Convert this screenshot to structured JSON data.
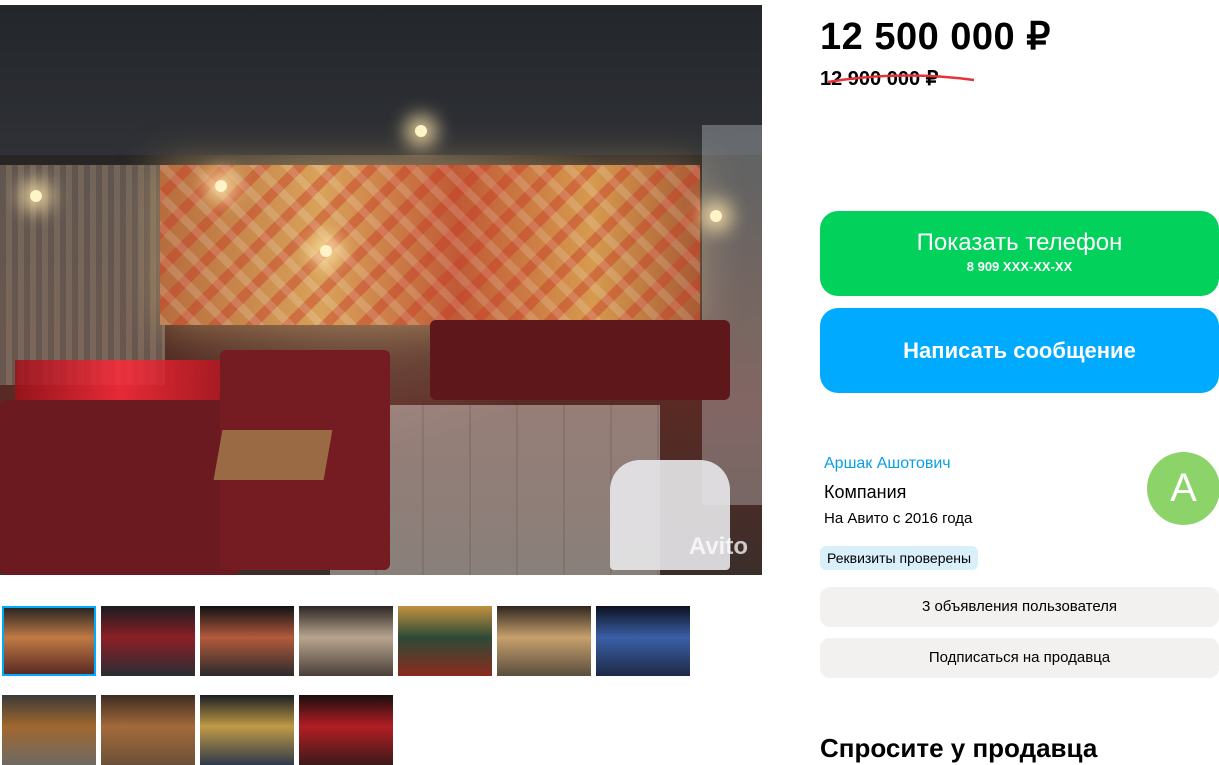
{
  "gallery": {
    "watermark": "Avito",
    "thumbnails": [
      {
        "alt": "photo-1",
        "colors": [
          "#5a2a24",
          "#c07a44",
          "#2a2624"
        ],
        "active": true
      },
      {
        "alt": "photo-2",
        "colors": [
          "#2b2c33",
          "#8b1f26",
          "#1a1c21"
        ]
      },
      {
        "alt": "photo-3",
        "colors": [
          "#2b2a2c",
          "#b35a3c",
          "#0f1014"
        ]
      },
      {
        "alt": "photo-4",
        "colors": [
          "#4a3f39",
          "#b8a58f",
          "#2c2623"
        ]
      },
      {
        "alt": "photo-5",
        "colors": [
          "#8a2b1e",
          "#2d4a37",
          "#c2913f"
        ]
      },
      {
        "alt": "photo-6",
        "colors": [
          "#5a4d3f",
          "#c7a06c",
          "#2e2620"
        ]
      },
      {
        "alt": "photo-7",
        "colors": [
          "#1d2a44",
          "#3b5fa6",
          "#0c1120"
        ]
      },
      {
        "alt": "photo-8",
        "colors": [
          "#6e6a63",
          "#a0682f",
          "#3c3a37"
        ]
      },
      {
        "alt": "photo-9",
        "colors": [
          "#6b5138",
          "#a36a3a",
          "#3d2c22"
        ]
      },
      {
        "alt": "photo-10",
        "colors": [
          "#2f3a4a",
          "#c09a45",
          "#1a1e24"
        ]
      },
      {
        "alt": "photo-11",
        "colors": [
          "#3c1a1a",
          "#b21e24",
          "#1a0e0e"
        ]
      }
    ]
  },
  "price": {
    "current": "12 500 000 ₽",
    "old": "12 900 000 ₽"
  },
  "actions": {
    "show_phone_label": "Показать телефон",
    "phone_masked": "8 909 XXX-XX-XX",
    "write_message_label": "Написать сообщение"
  },
  "seller": {
    "name": "Аршак Ашотович",
    "type": "Компания",
    "since": "На Авито с 2016 года",
    "avatar_letter": "А",
    "verified_badge": "Реквизиты проверены",
    "ads_link": "3 объявления пользователя",
    "subscribe_label": "Подписаться на продавца"
  },
  "ask_section": {
    "title": "Спросите у продавца"
  },
  "colors": {
    "green": "#02d15c",
    "blue": "#00aaff",
    "link": "#0a9ee6",
    "avatar": "#8cd46a",
    "strike": "#e8303a"
  }
}
